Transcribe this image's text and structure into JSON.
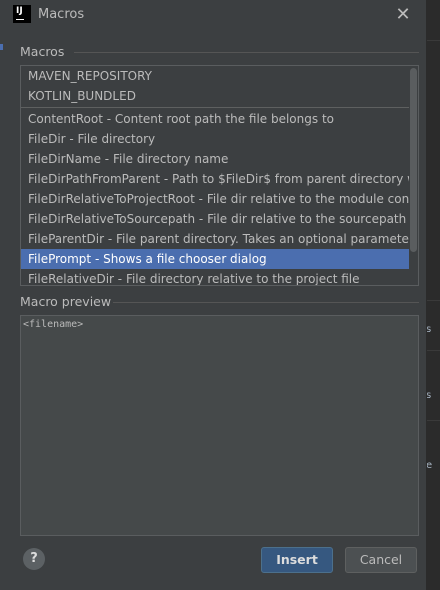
{
  "window": {
    "title": "Macros",
    "close_symbol": "✕",
    "app_icon_text": "IJ"
  },
  "macros_section": {
    "label": "Macros"
  },
  "macros": {
    "pinned": [
      "MAVEN_REPOSITORY",
      "KOTLIN_BUNDLED"
    ],
    "items": [
      "ContentRoot - Content root path the file belongs to",
      "FileDir - File directory",
      "FileDirName - File directory name",
      "FileDirPathFromParent - Path to $FileDir$ from parent directory with",
      "FileDirRelativeToProjectRoot - File dir relative to the module conten",
      "FileDirRelativeToSourcepath - File dir relative to the sourcepath roo",
      "FileParentDir - File parent directory. Takes an optional parameter(n",
      "FilePrompt - Shows a file chooser dialog",
      "FileRelativeDir - File directory relative to the project file"
    ],
    "selected_item": "FilePrompt - Shows a file chooser dialog"
  },
  "preview_section": {
    "label": "Macro preview",
    "text": "<filename>"
  },
  "buttons": {
    "help": "?",
    "insert": "Insert",
    "cancel": "Cancel"
  },
  "background_fragments": [
    "s",
    "e"
  ],
  "colors": {
    "selection": "#4b6eaf",
    "insert_button": "#365880",
    "dialog_bg": "#3c3f41"
  }
}
